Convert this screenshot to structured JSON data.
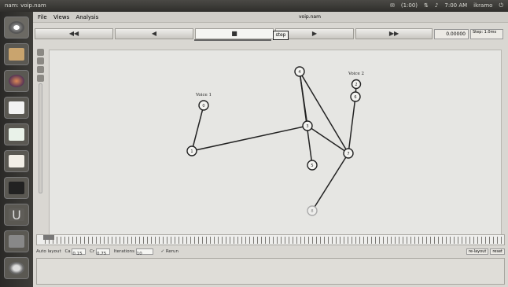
{
  "topbar": {
    "title": "nam: voip.nam",
    "tray": [
      "(1:00)",
      "7:00 AM",
      "ikramo"
    ]
  },
  "launcher": {
    "items": [
      "dash-icon",
      "files-icon",
      "firefox-icon",
      "writer-icon",
      "calc-icon",
      "impress-icon",
      "terminal-icon",
      "ubuntu-one-icon",
      "settings-icon"
    ]
  },
  "menu": {
    "file": "File",
    "views": "Views",
    "analysis": "Analysis",
    "window_title": "voip.nam"
  },
  "toolbar": {
    "rewind": "◀◀",
    "back": "◀",
    "stop": "■",
    "play": "▶",
    "forward": "▶▶",
    "step_badge": "step",
    "time": "0.00000",
    "speed_label": "Step: 1.0ms"
  },
  "canvas": {
    "nodes": [
      {
        "id": "0",
        "label": "Voice 1"
      },
      {
        "id": "1",
        "label": ""
      },
      {
        "id": "2",
        "label": "Voice 2"
      },
      {
        "id": "3",
        "label": ""
      },
      {
        "id": "4",
        "label": ""
      },
      {
        "id": "5",
        "label": ""
      },
      {
        "id": "6",
        "label": ""
      },
      {
        "id": "7",
        "label": ""
      },
      {
        "id": "8",
        "label": ""
      }
    ]
  },
  "statusbar": {
    "auto_layout": "Auto layout",
    "ca_label": "Ca",
    "ca_value": "0.15",
    "cr_label": "Cr",
    "cr_value": "0.75",
    "iterations_label": "Iterations",
    "iterations_value": "10",
    "rerun": "Rerun"
  },
  "bottom": {
    "relayout": "re-layout",
    "reset": "reset"
  }
}
